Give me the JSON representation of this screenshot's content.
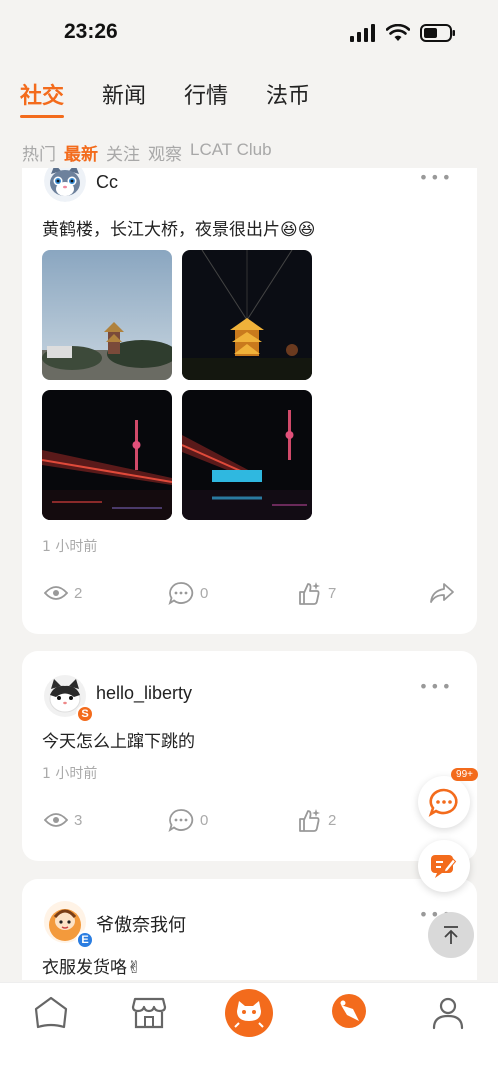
{
  "status_bar": {
    "time": "23:26"
  },
  "top_tabs": [
    {
      "label": "社交",
      "active": true
    },
    {
      "label": "新闻",
      "active": false
    },
    {
      "label": "行情",
      "active": false
    },
    {
      "label": "法币",
      "active": false
    }
  ],
  "sub_tabs": [
    {
      "label": "热门",
      "active": false
    },
    {
      "label": "最新",
      "active": true
    },
    {
      "label": "关注",
      "active": false
    },
    {
      "label": "观察",
      "active": false
    },
    {
      "label": "LCAT Club",
      "active": false
    }
  ],
  "posts": [
    {
      "username": "Cc",
      "text": "黄鹤楼，长江大桥，夜景很出片😆😆",
      "time": "1 小时前",
      "views": "2",
      "comments": "0",
      "likes": "7"
    },
    {
      "username": "hello_liberty",
      "avatar_badge": "S",
      "text": "今天怎么上蹿下跳的",
      "time": "1 小时前",
      "views": "3",
      "comments": "0",
      "likes": "2"
    },
    {
      "username": "爷傲奈我何",
      "avatar_badge": "E",
      "text": "衣服发货咯✌"
    }
  ],
  "floating": {
    "chat_badge": "99+"
  },
  "colors": {
    "accent": "#f36b1c"
  }
}
